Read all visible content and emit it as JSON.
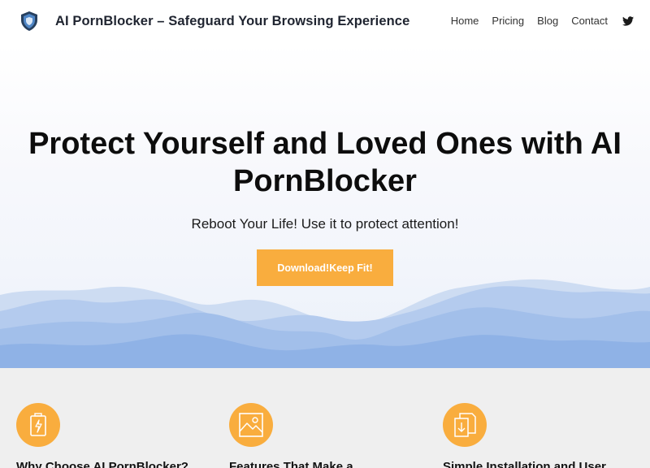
{
  "header": {
    "site_title": "AI PornBlocker – Safeguard Your Browsing Experience",
    "nav": [
      "Home",
      "Pricing",
      "Blog",
      "Contact"
    ],
    "logo_icon": "shield-icon",
    "social_icon": "twitter-icon"
  },
  "hero": {
    "title": "Protect Yourself and Loved Ones with AI PornBlocker",
    "subtitle": "Reboot Your Life! Use it to protect attention!",
    "cta_label": "Download!Keep Fit!"
  },
  "features": [
    {
      "icon": "battery-icon",
      "title": "Why Choose AI PornBlocker?"
    },
    {
      "icon": "image-icon",
      "title": "Features That Make a"
    },
    {
      "icon": "download-file-icon",
      "title": "Simple Installation and User"
    }
  ],
  "colors": {
    "accent": "#f9ad3e",
    "mountain": "#a9c4ec",
    "features_bg": "#efefef"
  }
}
